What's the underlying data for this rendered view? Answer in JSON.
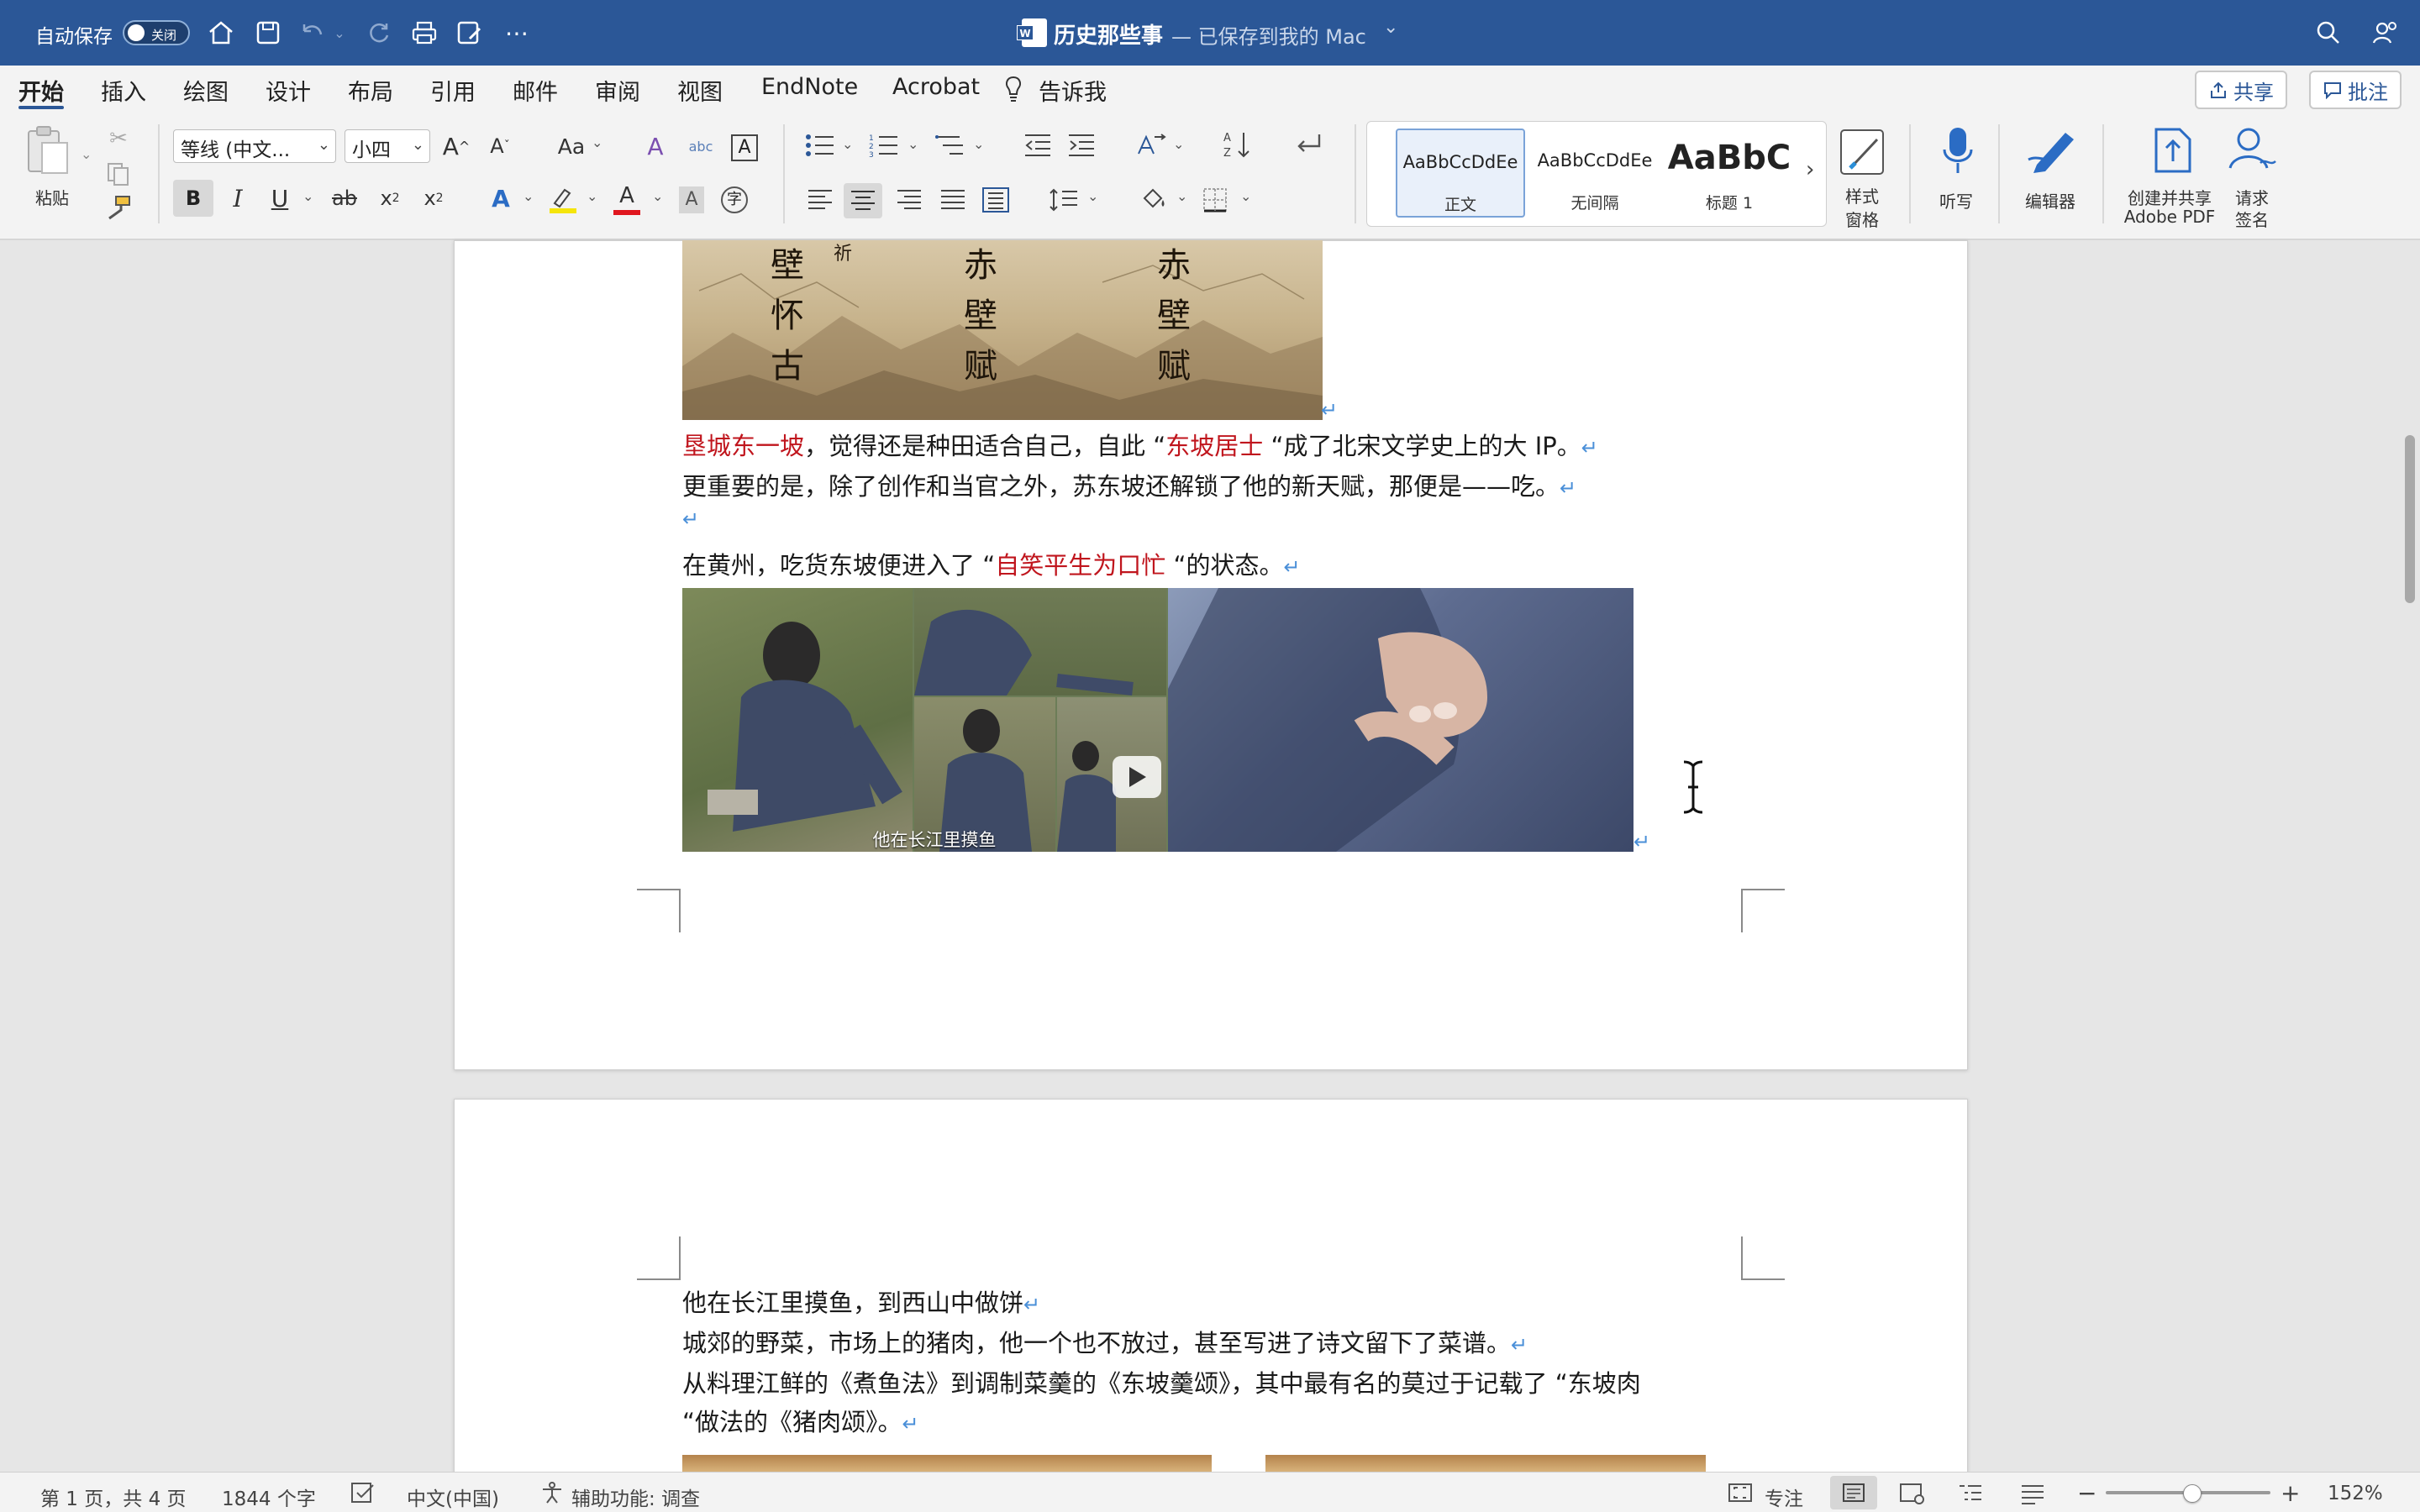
{
  "titlebar": {
    "autosave_label": "自动保存",
    "autosave_state": "关闭",
    "doc_title": "历史那些事",
    "doc_status": " — 已保存到我的 Mac",
    "chevron": "⌄"
  },
  "tabs": [
    "开始",
    "插入",
    "绘图",
    "设计",
    "布局",
    "引用",
    "邮件",
    "审阅",
    "视图",
    "EndNote",
    "Acrobat"
  ],
  "tell_me": "告诉我",
  "share_label": "共享",
  "comments_label": "批注",
  "ribbon": {
    "paste_label": "粘贴",
    "font_name": "等线 (中文...",
    "font_size": "小四",
    "case_label": "Aa",
    "styles": [
      {
        "sample": "AaBbCcDdEe",
        "name": "正文",
        "selected": true
      },
      {
        "sample": "AaBbCcDdEe",
        "name": "无间隔",
        "selected": false
      },
      {
        "sample": "AaBbC",
        "name": "标题 1",
        "selected": false
      }
    ],
    "style_pane_label_1": "样式",
    "style_pane_label_2": "窗格",
    "dictate_label": "听写",
    "editor_label": "编辑器",
    "create_pdf_label_1": "创建并共享",
    "create_pdf_label_2": "Adobe PDF",
    "request_sign_label_1": "请求",
    "request_sign_label_2": "签名",
    "bold": "B",
    "italic": "I",
    "underline": "U",
    "strike": "ab",
    "subscript": "x",
    "superscript": "x"
  },
  "document": {
    "image1_chars": [
      [
        "壁",
        "怀",
        "古"
      ],
      [
        "赤",
        "壁",
        "赋"
      ],
      [
        "赤",
        "壁",
        "赋"
      ]
    ],
    "image1_small": "祈",
    "line1": {
      "red_a": "垦城东一坡",
      "mid": "，觉得还是种田适合自己，自此 “",
      "red_b": "东坡居士",
      "end": " “成了北宋文学史上的大 IP。"
    },
    "line2": "更重要的是，除了创作和当官之外，苏东坡还解锁了他的新天赋，那便是——吃。",
    "line3": {
      "pre": "在黄州，吃货东坡便进入了 “",
      "red": "自笑平生为口忙",
      "end": " “的状态。"
    },
    "video_caption": "他在长江里摸鱼",
    "page2_lines": [
      "他在长江里摸鱼，到西山中做饼",
      "城郊的野菜，市场上的猪肉，他一个也不放过，甚至写进了诗文留下了菜谱。",
      "从料理江鲜的《煮鱼法》到调制菜羹的《东坡羹颂》，其中最有名的莫过于记载了 “东坡肉",
      " “做法的《猪肉颂》。"
    ],
    "para_mark": "↵"
  },
  "statusbar": {
    "page_info": "第 1 页，共 4 页",
    "word_count": "1844 个字",
    "language": "中文(中国)",
    "accessibility": "辅助功能: 调查",
    "focus": "专注",
    "zoom": "152%",
    "minus": "−",
    "plus": "+"
  },
  "colors": {
    "titlebar": "#2b5797",
    "accent_red": "#c0151d",
    "para_mark": "#4a8fd8"
  }
}
